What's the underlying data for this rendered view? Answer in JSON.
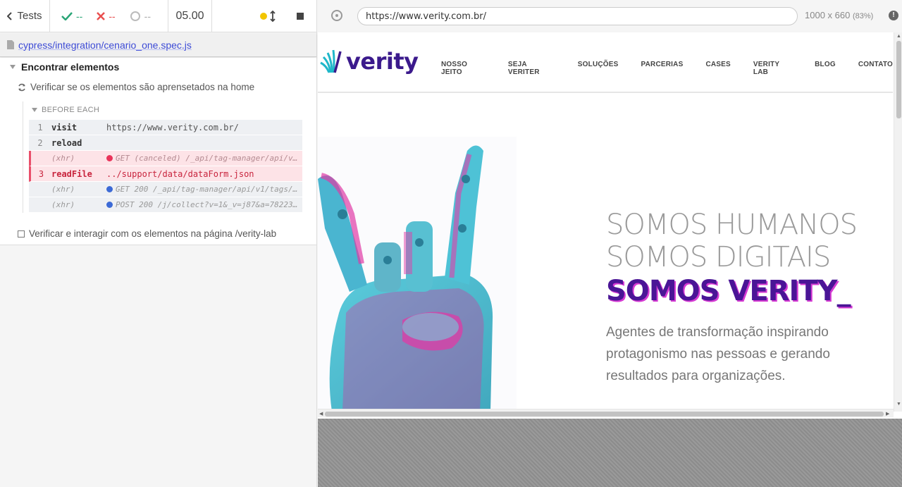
{
  "reporter": {
    "back_label": "Tests",
    "passed": "--",
    "failed": "--",
    "pending": "--",
    "duration": "05.00",
    "spec_path": "cypress/integration/cenario_one.spec.js",
    "suite_title": "Encontrar elementos",
    "test_one": "Verificar se os elementos são aprensetados na home",
    "hook_label": "BEFORE EACH",
    "commands": [
      {
        "num": "1",
        "name": "visit",
        "msg": "https://www.verity.com.br/"
      },
      {
        "num": "2",
        "name": "reload",
        "msg": ""
      },
      {
        "num": "",
        "name": "(xhr)",
        "msg": "GET (canceled) /_api/tag-manager/api/v1/t…"
      },
      {
        "num": "3",
        "name": "readFile",
        "msg": "../support/data/dataForm.json"
      },
      {
        "num": "",
        "name": "(xhr)",
        "msg": "GET 200 /_api/tag-manager/api/v1/tags/sit…"
      },
      {
        "num": "",
        "name": "(xhr)",
        "msg": "POST 200 /j/collect?v=1&_v=j87&a=78223855…"
      }
    ],
    "test_two": "Verificar e interagir com os elementos na página /verity-lab"
  },
  "aut": {
    "url": "https://www.verity.com.br/",
    "viewport": "1000 x 660",
    "scale": "(83%)"
  },
  "site": {
    "logo_text": "verity",
    "nav": [
      "NOSSO JEITO",
      "SEJA VERITER",
      "SOLUÇÕES",
      "PARCERIAS",
      "CASES",
      "VERITY LAB",
      "BLOG",
      "CONTATO"
    ],
    "hero_line1": "SOMOS HUMANOS",
    "hero_line2": "SOMOS DIGITAIS",
    "hero_line3": "SOMOS VERITY_",
    "hero_sub": "Agentes de transformação inspirando protagonismo nas pessoas e gerando resultados para organizações."
  },
  "colors": {
    "accent": "#3c4ad6",
    "brand": "#4a1596",
    "pass": "#2aa577",
    "fail": "#e94f4f"
  }
}
